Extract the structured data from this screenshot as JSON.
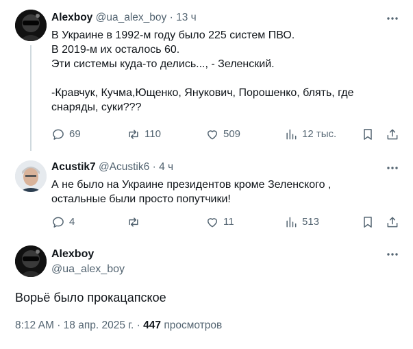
{
  "tweet1": {
    "name": "Alexboy",
    "handle": "@ua_alex_boy",
    "time": "13 ч",
    "text": "В Украине в 1992-м году было 225 систем ПВО.\nВ 2019-м их осталось 60.\nЭти системы куда-то делись..., - Зеленский.\n\n-Кравчук, Кучма,Ющенко, Янукович, Порошенко, блять, где\nснаряды, суки???",
    "replies": "69",
    "reposts": "110",
    "likes": "509",
    "views": "12 тыс."
  },
  "tweet2": {
    "name": "Acustik7",
    "handle": "@Acustik6",
    "time": "4 ч",
    "text": "А не было на Украине президентов кроме Зеленского ,\nостальные были просто попутчики!",
    "replies": "4",
    "reposts": "",
    "likes": "11",
    "views": "513"
  },
  "main": {
    "name": "Alexboy",
    "handle": "@ua_alex_boy",
    "text": "Ворьё было прокацапское",
    "time": "8:12 AM",
    "date": "18 апр. 2025 г.",
    "views_count": "447",
    "views_label": "просмотров"
  },
  "icons": {
    "more": "more-dots-icon",
    "reply": "reply-bubble-icon",
    "repost": "repost-arrows-icon",
    "like": "heart-icon",
    "views": "views-bars-icon",
    "bookmark": "bookmark-icon",
    "share": "share-upload-icon"
  },
  "colors": {
    "text": "#0f1419",
    "secondary": "#536471",
    "thread_line": "#cfd9de"
  }
}
